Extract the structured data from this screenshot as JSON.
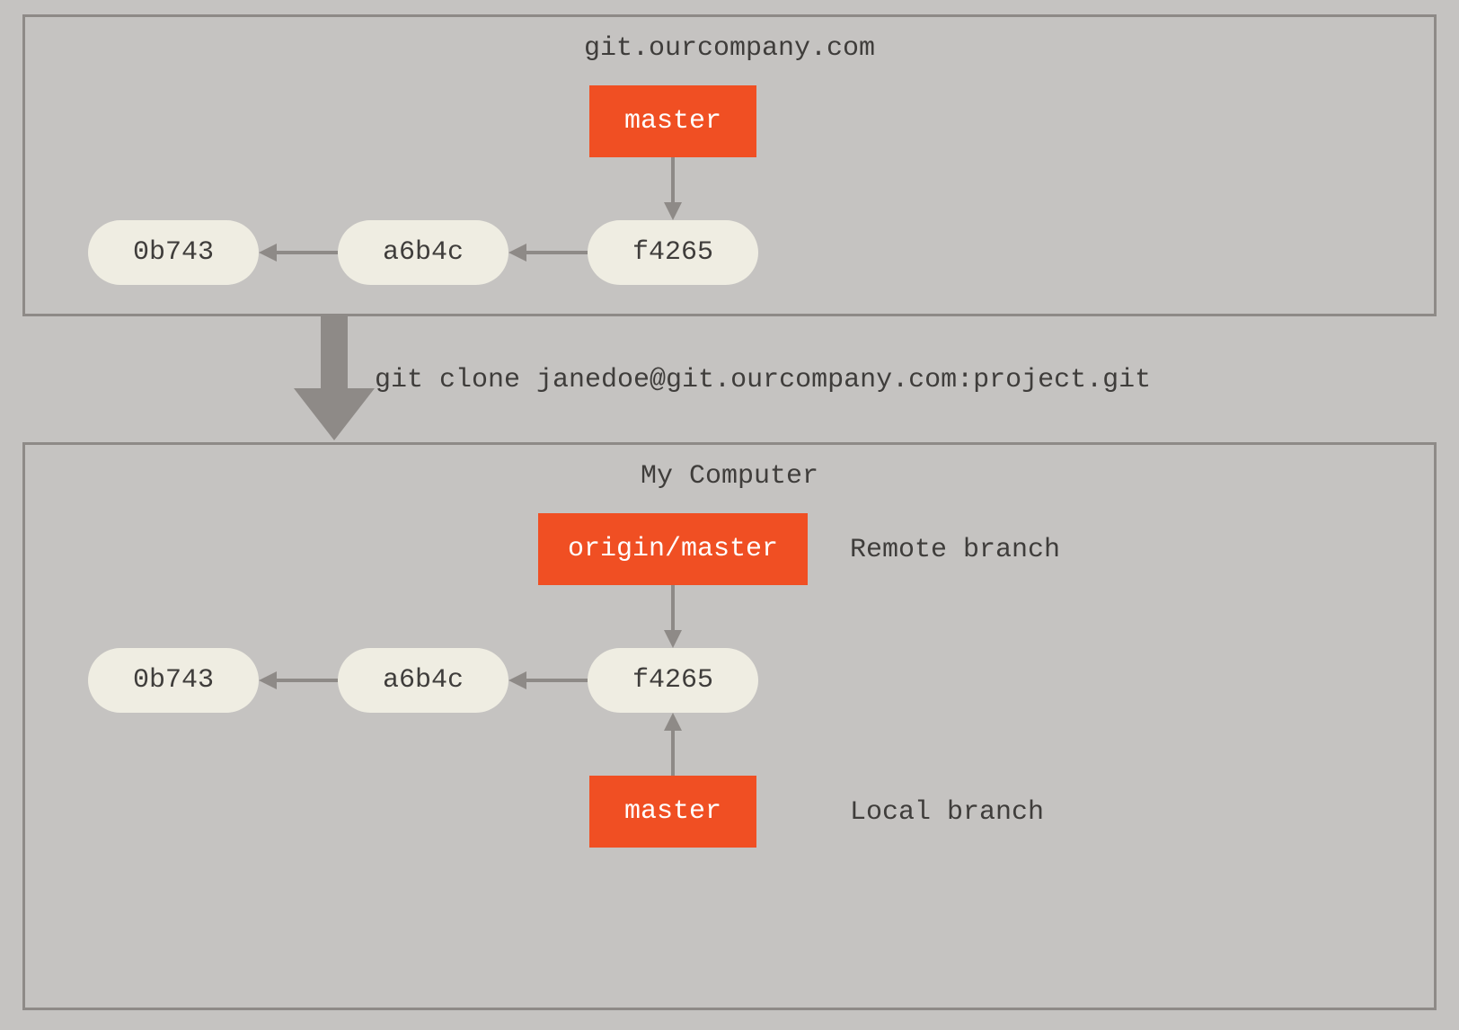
{
  "server": {
    "title": "git.ourcompany.com",
    "branch": "master",
    "commits": [
      "0b743",
      "a6b4c",
      "f4265"
    ]
  },
  "clone_command": "git clone janedoe@git.ourcompany.com:project.git",
  "local": {
    "title": "My Computer",
    "remote_branch": "origin/master",
    "remote_branch_label": "Remote branch",
    "local_branch": "master",
    "local_branch_label": "Local branch",
    "commits": [
      "0b743",
      "a6b4c",
      "f4265"
    ]
  }
}
